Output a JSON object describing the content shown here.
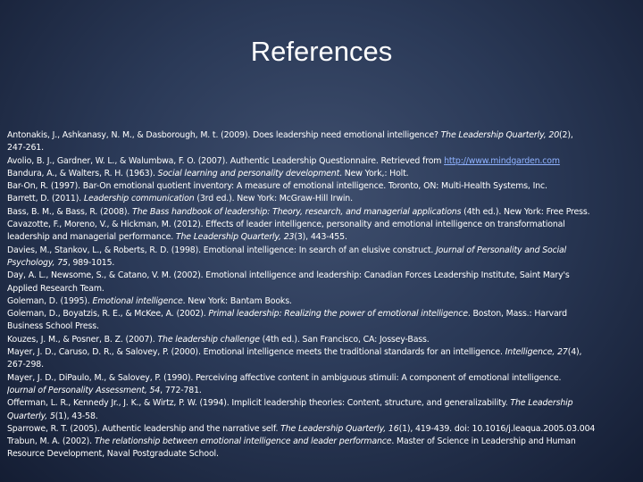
{
  "title": "References",
  "references": [
    {
      "lines": [
        [
          {
            "t": "Antonakis, J., Ashkanasy, N. M., & Dasborough, M. t. (2009). Does leadership need emotional intelligence? "
          },
          {
            "t": "The Leadership Quarterly, 20",
            "i": true
          },
          {
            "t": "(2),"
          }
        ],
        [
          {
            "t": "247-261."
          }
        ]
      ]
    },
    {
      "lines": [
        [
          {
            "t": "Avolio, B. J., Gardner, W. L., & Walumbwa, F. O. (2007). Authentic Leadership Questionnaire. Retrieved from "
          },
          {
            "t": "http://www.mindgarden.com",
            "link": true
          }
        ]
      ]
    },
    {
      "lines": [
        [
          {
            "t": "Bandura, A., & Walters, R. H. (1963). "
          },
          {
            "t": "Social learning and personality development",
            "i": true
          },
          {
            "t": ". New York,: Holt."
          }
        ]
      ]
    },
    {
      "lines": [
        [
          {
            "t": "Bar-On, R. (1997). Bar-On emotional quotient inventory: A measure of emotional intelligence. Toronto, ON: Multi-Health Systems, Inc."
          }
        ]
      ]
    },
    {
      "lines": [
        [
          {
            "t": "Barrett, D. (2011). "
          },
          {
            "t": "Leadership communication",
            "i": true
          },
          {
            "t": " (3rd ed.). New York: McGraw-Hill Irwin."
          }
        ]
      ]
    },
    {
      "lines": [
        [
          {
            "t": "Bass, B. M., & Bass, R. (2008). "
          },
          {
            "t": "The Bass handbook of leadership: Theory, research, and managerial applications",
            "i": true
          },
          {
            "t": " (4th ed.). New York: Free Press."
          }
        ]
      ]
    },
    {
      "lines": [
        [
          {
            "t": "Cavazotte, F., Moreno, V., & Hickman, M. (2012). Effects of leader intelligence, personality and emotional intelligence on transformational"
          }
        ],
        [
          {
            "t": "leadership and managerial performance. "
          },
          {
            "t": "The Leadership Quarterly, 23",
            "i": true
          },
          {
            "t": "(3), 443-455."
          }
        ]
      ]
    },
    {
      "lines": [
        [
          {
            "t": "Davies, M., Stankov, L., & Roberts, R. D. (1998). Emotional intelligence: In search of an elusive construct. "
          },
          {
            "t": "Journal of Personality and Social",
            "i": true
          }
        ],
        [
          {
            "t": "Psychology, 75",
            "i": true
          },
          {
            "t": ", 989-1015."
          }
        ]
      ]
    },
    {
      "lines": [
        [
          {
            "t": "Day, A. L., Newsome, S., & Catano, V. M. (2002). Emotional intelligence and leadership: Canadian Forces Leadership Institute, Saint Mary's"
          }
        ],
        [
          {
            "t": "Applied Research Team."
          }
        ]
      ]
    },
    {
      "lines": [
        [
          {
            "t": "Goleman, D. (1995). "
          },
          {
            "t": "Emotional intelligence",
            "i": true
          },
          {
            "t": ". New York: Bantam Books."
          }
        ]
      ]
    },
    {
      "lines": [
        [
          {
            "t": "Goleman, D., Boyatzis, R. E., & McKee, A. (2002). "
          },
          {
            "t": "Primal leadership: Realizing the power of emotional intelligence",
            "i": true
          },
          {
            "t": ". Boston, Mass.: Harvard"
          }
        ],
        [
          {
            "t": "Business School Press."
          }
        ]
      ]
    },
    {
      "lines": [
        [
          {
            "t": "Kouzes, J. M., & Posner, B. Z. (2007). "
          },
          {
            "t": "The leadership challenge",
            "i": true
          },
          {
            "t": " (4th ed.). San Francisco, CA: Jossey-Bass."
          }
        ]
      ]
    },
    {
      "lines": [
        [
          {
            "t": "Mayer, J. D., Caruso, D. R., & Salovey, P. (2000). Emotional intelligence meets the traditional standards for an intelligence. "
          },
          {
            "t": "Intelligence, 27",
            "i": true
          },
          {
            "t": "(4),"
          }
        ],
        [
          {
            "t": "267-298."
          }
        ]
      ]
    },
    {
      "lines": [
        [
          {
            "t": "Mayer, J. D., DiPaulo, M., & Salovey, P. (1990). Perceiving affective content in ambiguous stimuli: A component of emotional intelligence."
          }
        ],
        [
          {
            "t": "Journal of Personality Assessment, 54",
            "i": true
          },
          {
            "t": ", 772-781."
          }
        ]
      ]
    },
    {
      "lines": [
        [
          {
            "t": "Offerman, L. R., Kennedy Jr., J. K., & Wirtz, P. W. (1994). Implicit leadership theories: Content, structure, and generalizability. "
          },
          {
            "t": "The Leadership",
            "i": true
          }
        ],
        [
          {
            "t": "Quarterly, 5",
            "i": true
          },
          {
            "t": "(1), 43-58."
          }
        ]
      ]
    },
    {
      "lines": [
        [
          {
            "t": "Sparrowe, R. T. (2005). Authentic leadership and the narrative self. "
          },
          {
            "t": "The Leadership Quarterly, 16",
            "i": true
          },
          {
            "t": "(1), 419-439. doi: 10.1016/j.leaqua.2005.03.004"
          }
        ]
      ]
    },
    {
      "lines": [
        [
          {
            "t": "Trabun, M. A. (2002). "
          },
          {
            "t": "The relationship between emotional intelligence and leader performance",
            "i": true
          },
          {
            "t": ". Master of Science in Leadership and Human"
          }
        ],
        [
          {
            "t": "Resource Development, Naval Postgraduate School."
          }
        ]
      ]
    }
  ]
}
